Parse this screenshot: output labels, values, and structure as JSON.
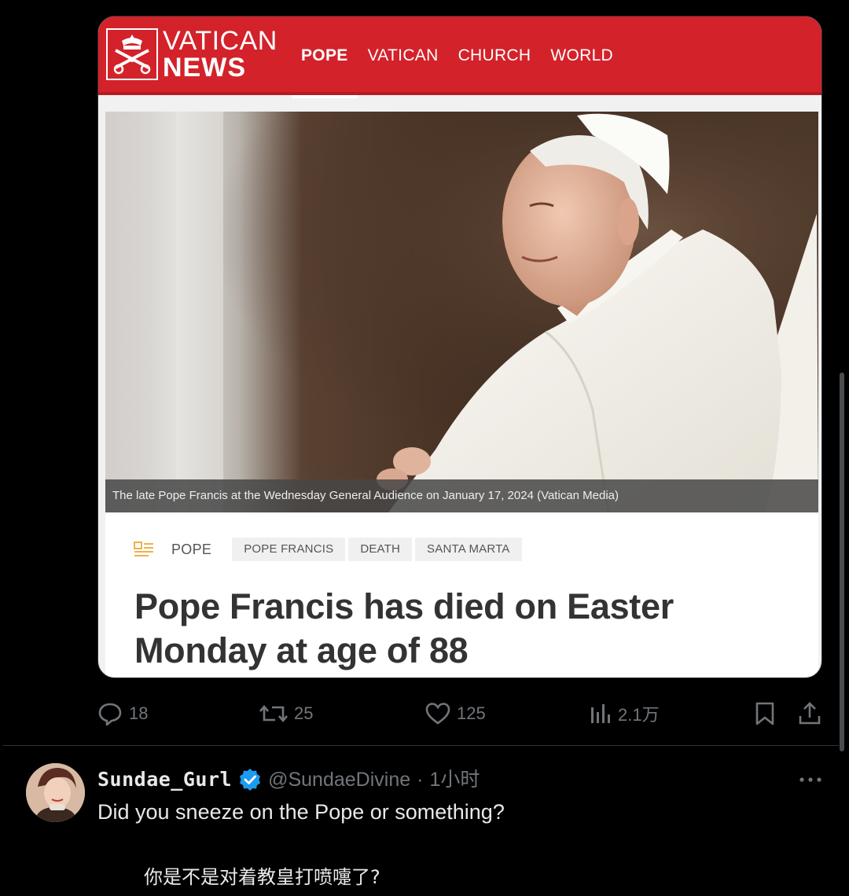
{
  "site": {
    "brand_top": "VATICAN",
    "brand_bottom": "NEWS",
    "nav": [
      {
        "label": "POPE",
        "active": true
      },
      {
        "label": "VATICAN",
        "active": false
      },
      {
        "label": "CHURCH",
        "active": false
      },
      {
        "label": "WORLD",
        "active": false
      }
    ],
    "accent_color": "#d3222a"
  },
  "article": {
    "caption": "The late Pope Francis at the Wednesday General Audience on January 17, 2024  (Vatican Media)",
    "category": "POPE",
    "tags": [
      "POPE FRANCIS",
      "DEATH",
      "SANTA MARTA"
    ],
    "headline": "Pope Francis has died on Easter Monday at age of 88"
  },
  "post_actions": {
    "replies": "18",
    "reposts": "25",
    "likes": "125",
    "views": "2.1万"
  },
  "reply": {
    "display_name": "Sundae_Gurl",
    "handle": "@SundaeDivine",
    "separator": "·",
    "time": "1小时",
    "text": "Did you sneeze on the Pope or something?",
    "translation": "你是不是对着教皇打喷嚏了?"
  }
}
